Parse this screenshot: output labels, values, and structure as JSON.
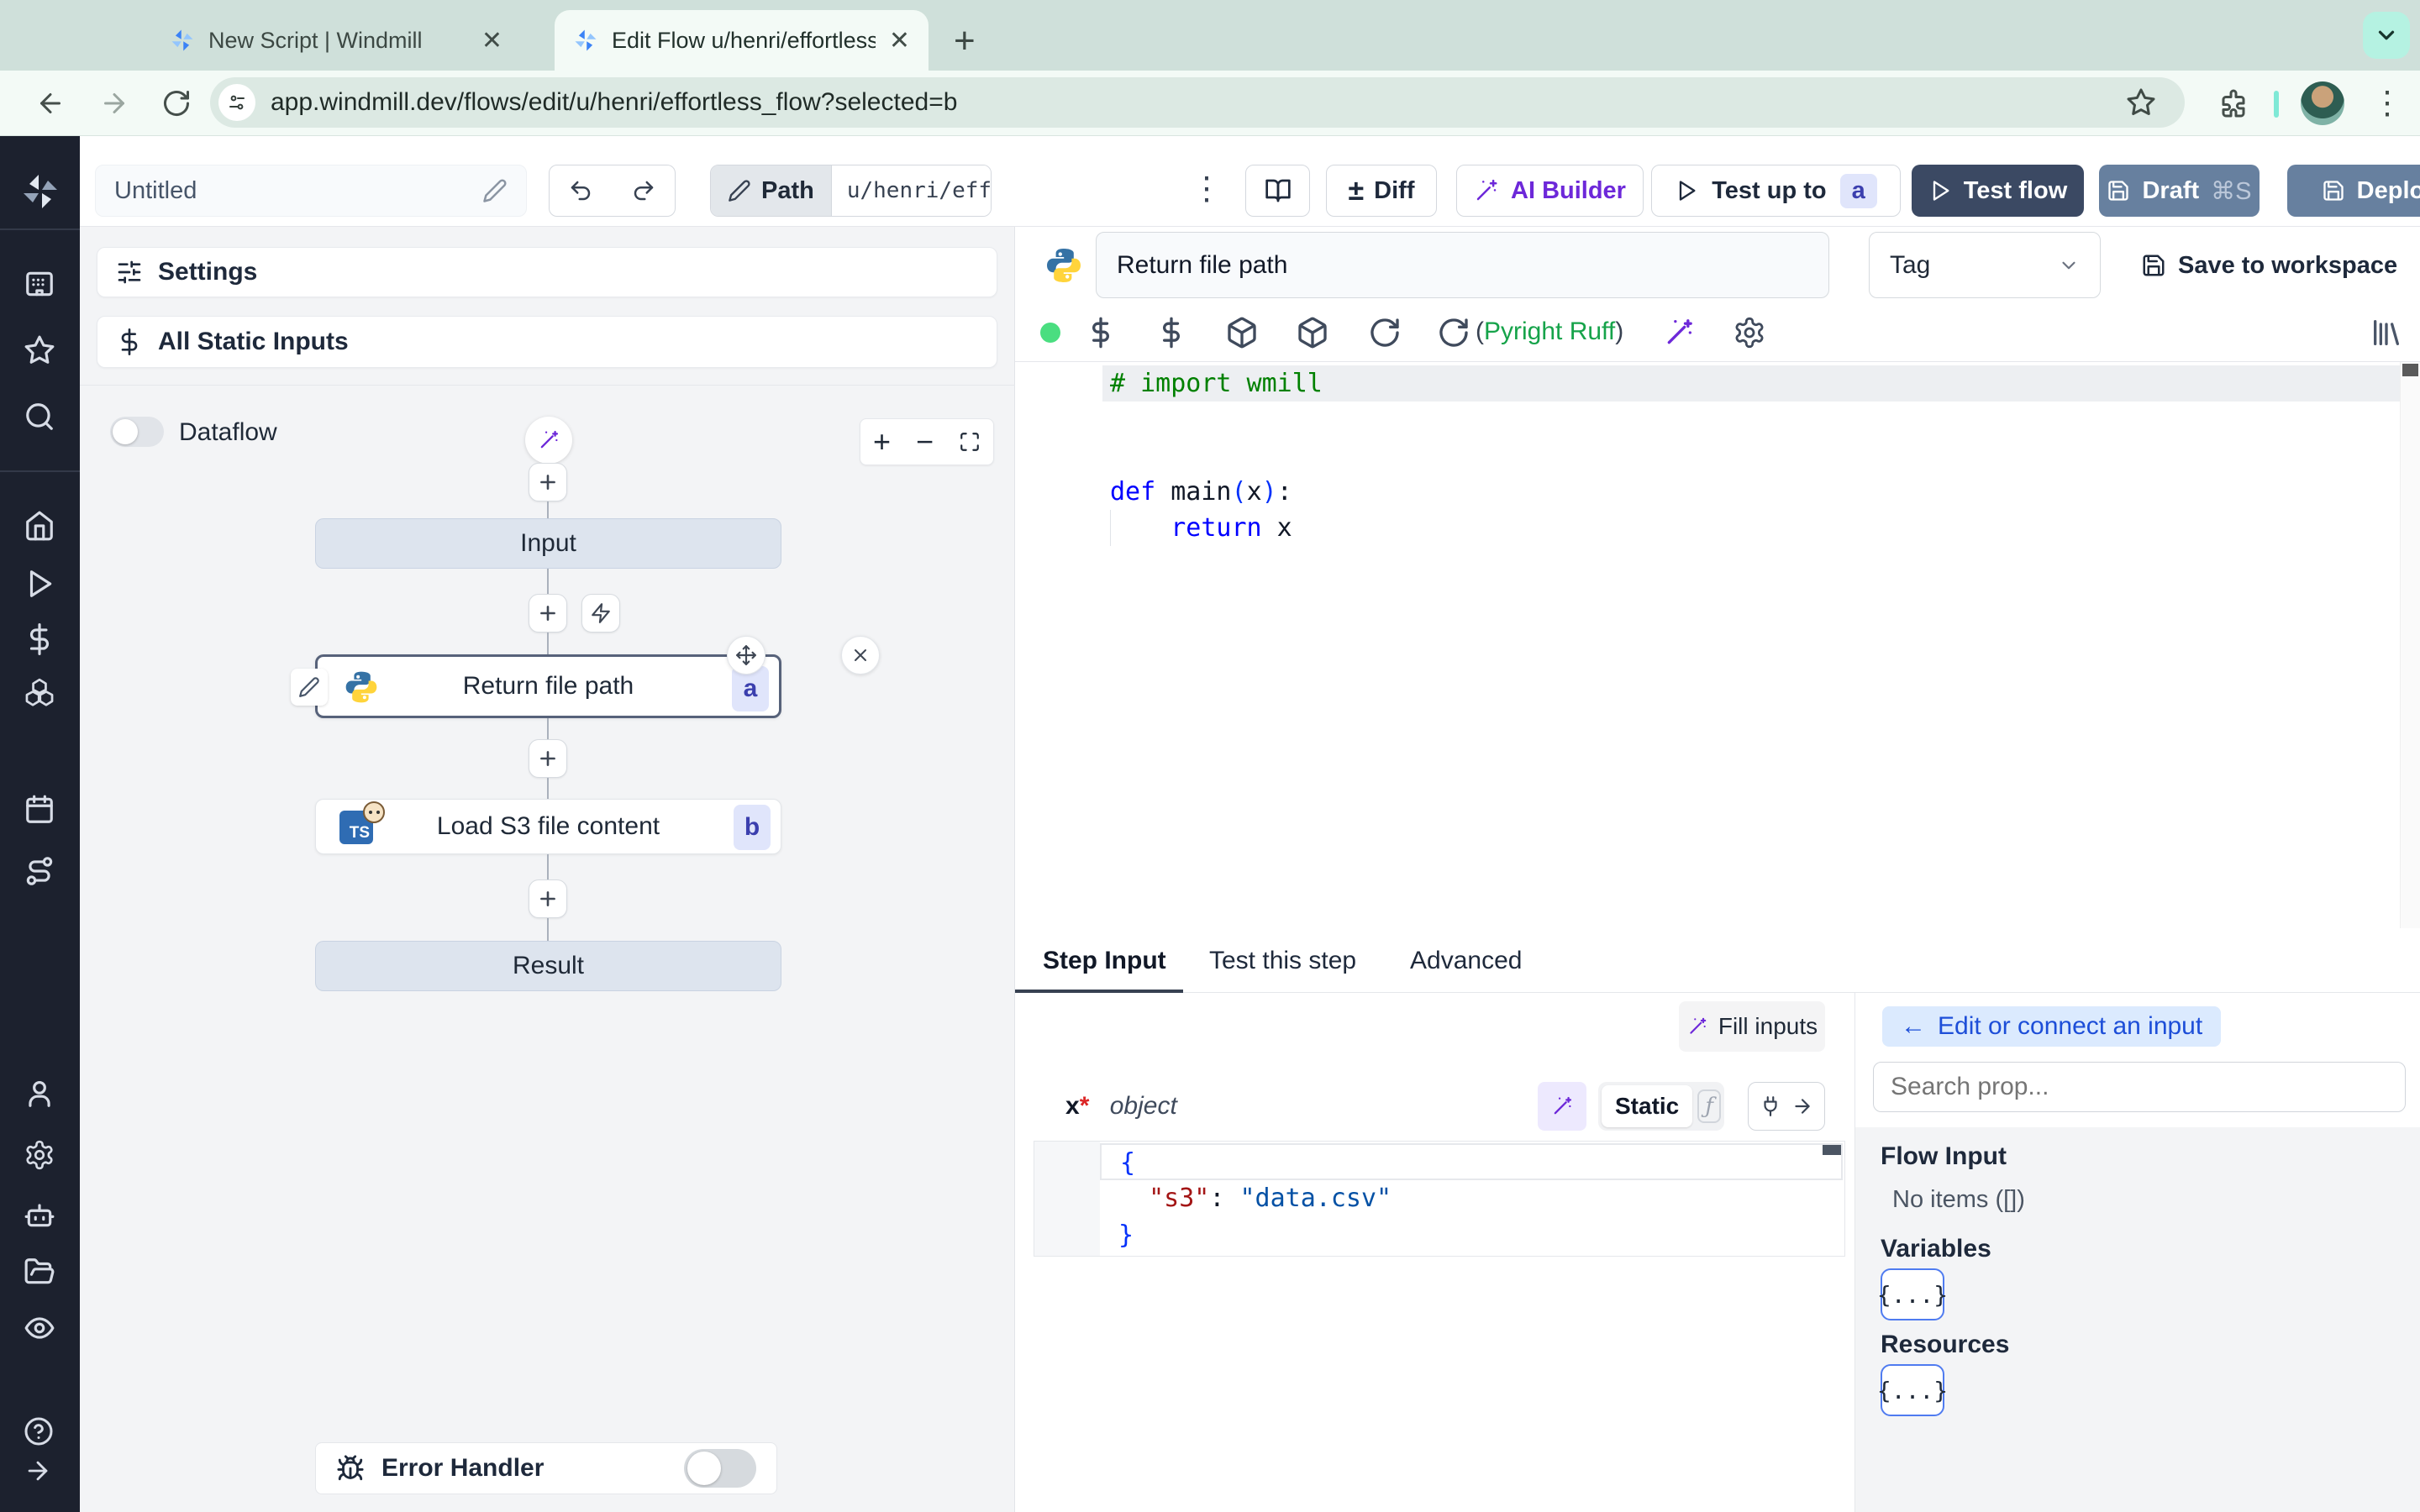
{
  "browser": {
    "tab1": "New Script | Windmill",
    "tab2": "Edit Flow u/henri/effortless_fl",
    "url": "app.windmill.dev/flows/edit/u/henri/effortless_flow?selected=b"
  },
  "topbar": {
    "title": "Untitled",
    "path_label": "Path",
    "path_value": "u/henri/eff",
    "diff": "Diff",
    "ai_builder": "AI Builder",
    "test_up_to": "Test up to",
    "test_badge": "a",
    "test_flow": "Test flow",
    "draft": "Draft",
    "draft_shortcut": "⌘S",
    "deploy": "Deploy"
  },
  "flow": {
    "settings": "Settings",
    "all_static_inputs": "All Static Inputs",
    "dataflow": "Dataflow",
    "input_node": "Input",
    "step_a": {
      "title": "Return file path",
      "badge": "a"
    },
    "step_b": {
      "title": "Load S3 file content",
      "badge": "b",
      "lang_icon": "TS"
    },
    "result_node": "Result",
    "error_handler": "Error Handler"
  },
  "editor": {
    "step_name": "Return file path",
    "tag": "Tag",
    "save_to_workspace": "Save to workspace",
    "lint_open": "(",
    "lint_name": "Pyright Ruff",
    "lint_close": ")",
    "code_lines": [
      [
        {
          "t": "# import wmill",
          "c": "comment"
        }
      ],
      [],
      [],
      [
        {
          "t": "def",
          "c": "kw"
        },
        {
          "t": " main",
          "c": "plain"
        },
        {
          "t": "(",
          "c": "paren"
        },
        {
          "t": "x",
          "c": "plain"
        },
        {
          "t": ")",
          "c": "paren"
        },
        {
          "t": ":",
          "c": "plain"
        }
      ],
      [
        {
          "t": "    ",
          "c": "plain"
        },
        {
          "t": "return",
          "c": "kw"
        },
        {
          "t": " x",
          "c": "plain"
        }
      ]
    ]
  },
  "bottom": {
    "tab_step_input": "Step Input",
    "tab_test_step": "Test this step",
    "tab_advanced": "Advanced",
    "fill_inputs": "Fill inputs",
    "field_name": "x",
    "field_required": "*",
    "field_type": "object",
    "static_label": "Static",
    "function_glyph": "ƒ",
    "json_lines": [
      [
        {
          "t": "{",
          "c": "brace"
        }
      ],
      [
        {
          "t": "  ",
          "c": "plain"
        },
        {
          "t": "\"s3\"",
          "c": "key"
        },
        {
          "t": ": ",
          "c": "plain"
        },
        {
          "t": "\"data.csv\"",
          "c": "str"
        }
      ],
      [
        {
          "t": "}",
          "c": "brace"
        }
      ]
    ]
  },
  "right_panel": {
    "back_arrow": "←",
    "edit_connect": "Edit or connect an input",
    "search_placeholder": "Search prop...",
    "flow_input": "Flow Input",
    "no_items": "No items ([])",
    "variables": "Variables",
    "resources": "Resources",
    "object_button": "{...}"
  },
  "colors": {
    "test_flow_button": "#3b4963",
    "draft_deploy_button": "#67809f",
    "ai_purple": "#6d28d9",
    "lint_green": "#16a34a",
    "step_badge_bg": "#e0e5fb",
    "step_badge_text": "#3b3fae",
    "connect_button_bg": "#dbeafe",
    "connect_button_text": "#1d4ed8",
    "status_dot": "#4ade80"
  }
}
